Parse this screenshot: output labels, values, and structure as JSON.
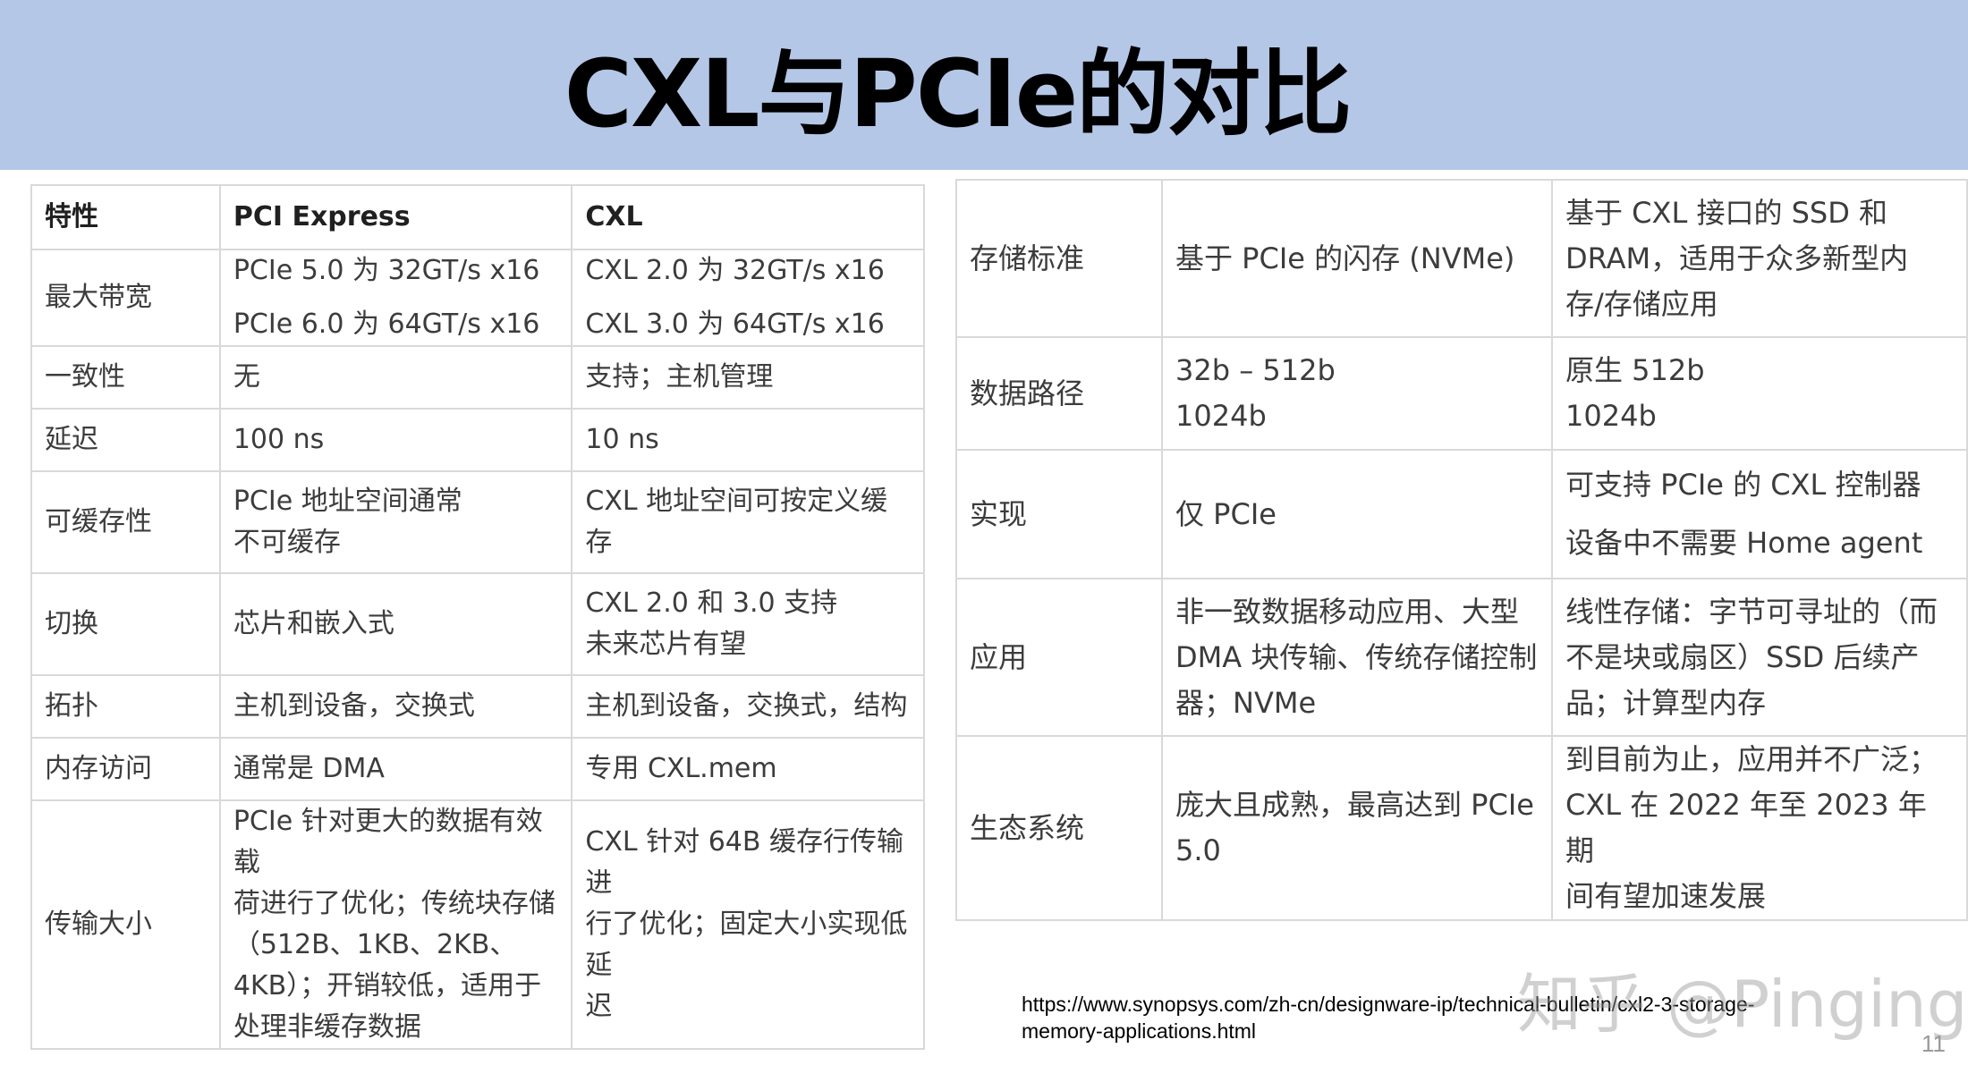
{
  "title": "CXL与PCIe的对比",
  "left_table": {
    "headers": [
      "特性",
      "PCI Express",
      "CXL"
    ],
    "rows": [
      {
        "feature": "最大带宽",
        "pcie": [
          "PCIe 5.0 为 32GT/s x16",
          "PCIe 6.0 为 64GT/s x16"
        ],
        "cxl": [
          "CXL 2.0 为 32GT/s x16",
          "CXL 3.0 为 64GT/s x16"
        ]
      },
      {
        "feature": "一致性",
        "pcie": [
          "无"
        ],
        "cxl": [
          "支持；主机管理"
        ]
      },
      {
        "feature": "延迟",
        "pcie": [
          "100 ns"
        ],
        "cxl": [
          "10 ns"
        ]
      },
      {
        "feature": "可缓存性",
        "pcie": [
          "PCIe 地址空间通常",
          "不可缓存"
        ],
        "cxl": [
          "CXL 地址空间可按定义缓存"
        ]
      },
      {
        "feature": "切换",
        "pcie": [
          "芯片和嵌入式"
        ],
        "cxl": [
          "CXL 2.0 和 3.0 支持",
          "未来芯片有望"
        ]
      },
      {
        "feature": "拓扑",
        "pcie": [
          "主机到设备，交换式"
        ],
        "cxl": [
          "主机到设备，交换式，结构"
        ]
      },
      {
        "feature": "内存访问",
        "pcie": [
          "通常是 DMA"
        ],
        "cxl": [
          "专用 CXL.mem"
        ]
      },
      {
        "feature": "传输大小",
        "pcie": [
          "PCIe 针对更大的数据有效载",
          "荷进行了优化；传统块存储",
          "（512B、1KB、2KB、",
          "4KB）；开销较低，适用于",
          "处理非缓存数据"
        ],
        "cxl": [
          "CXL 针对 64B 缓存行传输进",
          "行了优化；固定大小实现低延",
          "迟"
        ]
      }
    ]
  },
  "right_table": {
    "rows": [
      {
        "feature": "存储标准",
        "pcie": [
          "基于 PCIe 的闪存 (NVMe)"
        ],
        "cxl": [
          "基于 CXL 接口的 SSD 和",
          "DRAM，适用于众多新型内",
          "存/存储应用"
        ]
      },
      {
        "feature": "数据路径",
        "pcie": [
          "32b – 512b",
          "1024b"
        ],
        "cxl": [
          "原生 512b",
          "1024b"
        ]
      },
      {
        "feature": "实现",
        "pcie": [
          "仅 PCIe"
        ],
        "cxl": [
          "可支持 PCIe 的 CXL 控制器",
          "设备中不需要 Home agent"
        ]
      },
      {
        "feature": "应用",
        "pcie": [
          "非一致数据移动应用、大型",
          "DMA 块传输、传统存储控制",
          "器；NVMe"
        ],
        "cxl": [
          "线性存储：字节可寻址的（而",
          "不是块或扇区）SSD 后续产",
          "品；计算型内存"
        ]
      },
      {
        "feature": "生态系统",
        "pcie": [
          "庞大且成熟，最高达到 PCIe",
          "5.0"
        ],
        "cxl": [
          "到目前为止，应用并不广泛；",
          "CXL 在 2022 年至 2023 年期",
          "间有望加速发展"
        ]
      }
    ]
  },
  "footnote": {
    "line1": "https://www.synopsys.com/zh-cn/designware-ip/technical-bulletin/cxl2-3-storage-",
    "line2": "memory-applications.html"
  },
  "watermark": "知乎 @Pinging",
  "page_number": "11",
  "colors": {
    "header_bg": "#b4c7e7",
    "border": "#d9d9d9",
    "text": "#3c3c3c"
  }
}
